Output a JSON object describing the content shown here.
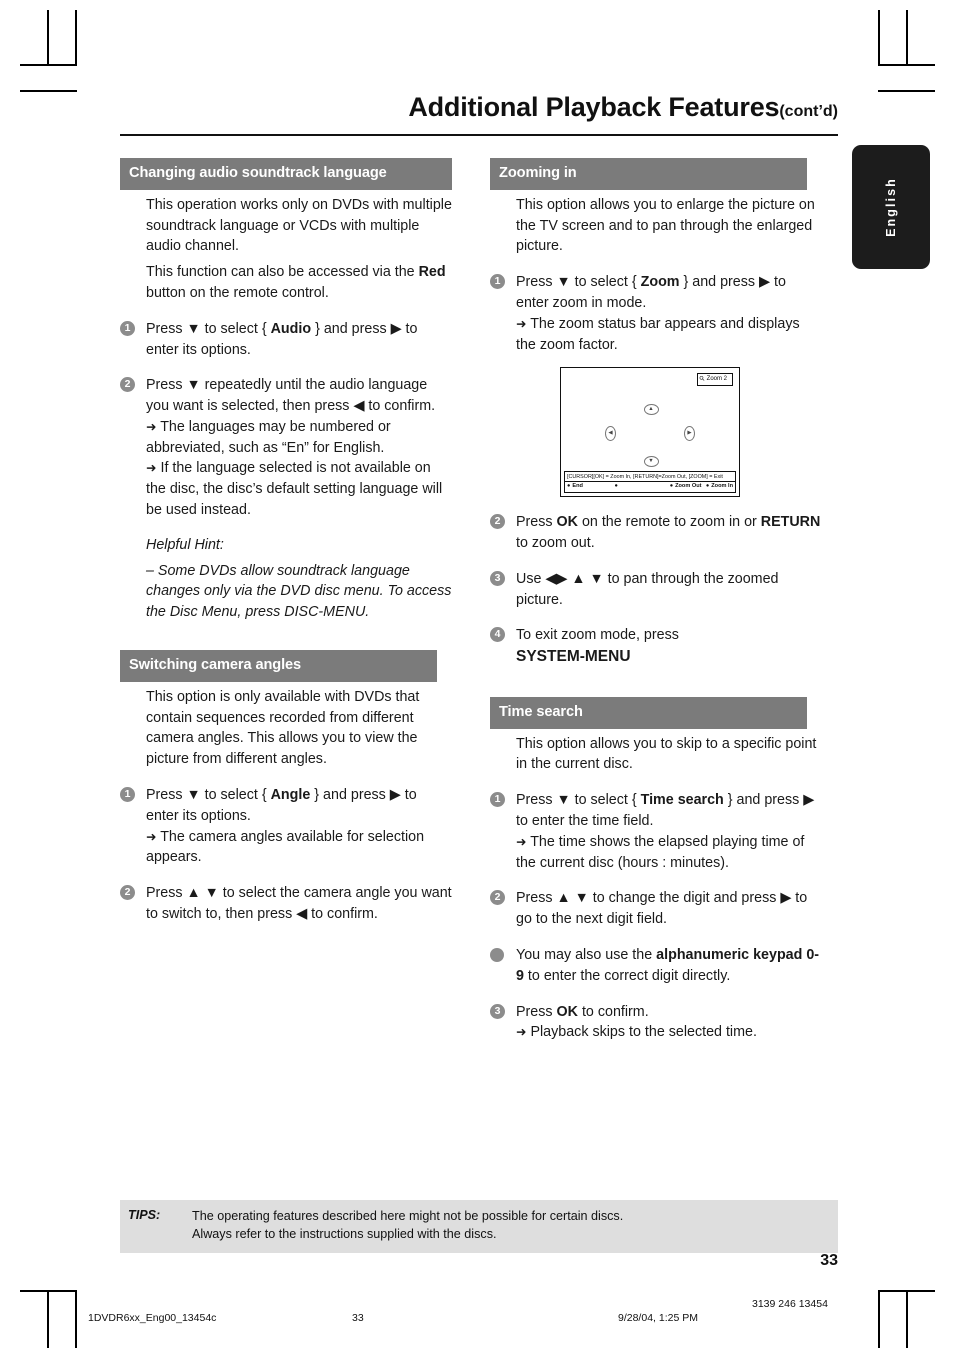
{
  "header": {
    "title": "Additional Playback Features",
    "title_suffix": "(cont’d)"
  },
  "language_tab": {
    "label": "English"
  },
  "left_column": {
    "section1": {
      "heading": "Changing audio soundtrack language",
      "intro_1": "This operation works only on DVDs with multiple soundtrack language or VCDs with multiple audio channel.",
      "intro_2_a": "This function can also be accessed via the ",
      "intro_2_b": "Red",
      "intro_2_c": " button on the remote control.",
      "steps": [
        {
          "num": "1",
          "text_a": "Press ▼  to select { ",
          "bold": "Audio",
          "text_b": " } and press ▶ to enter its options."
        },
        {
          "num": "2",
          "text_a": "Press ▼ repeatedly until the audio language you want is selected, then press ◀  to confirm.",
          "arrow_1": "The languages may be numbered or abbreviated, such as “En” for English.",
          "arrow_2": "If the language selected is not available on the disc, the disc’s default setting language will be used instead."
        }
      ],
      "hint_title": "Helpful Hint:",
      "hint_body": "–  Some DVDs allow soundtrack language changes only via the DVD disc menu. To access the Disc Menu, press DISC-MENU."
    },
    "section2": {
      "heading": "Switching camera angles",
      "intro": "This option is only available with DVDs that contain sequences recorded from different camera angles.  This allows you to view the picture from different angles.",
      "steps": [
        {
          "num": "1",
          "text_a": "Press ▼  to select { ",
          "bold": "Angle",
          "text_b": " } and press ▶ to enter its options.",
          "arrow_1": "The camera angles available for selection appears."
        },
        {
          "num": "2",
          "text_a": "Press ▲ ▼ to select the camera angle you want to switch to, then press ◀  to confirm."
        }
      ]
    }
  },
  "right_column": {
    "section1": {
      "heading": "Zooming in",
      "intro": "This option allows you to enlarge the picture on the TV screen and to pan through the enlarged picture.",
      "steps": [
        {
          "num": "1",
          "text_a": "Press ▼  to select { ",
          "bold": "Zoom",
          "text_b": " } and press ▶ to enter zoom in mode.",
          "arrow_1": "The zoom status bar appears and displays the zoom factor."
        },
        {
          "num": "2",
          "text_a": "Press ",
          "bold": "OK",
          "text_b": " on the remote to zoom in or ",
          "bold2": "RETURN",
          "text_c": " to zoom out."
        },
        {
          "num": "3",
          "text_a": "Use ◀▶ ▲ ▼ to pan through the zoomed picture."
        },
        {
          "num": "4",
          "text_a": "To exit zoom mode, press ",
          "bold": "SYSTEM-MENU"
        }
      ],
      "figure": {
        "zoom_badge": "Zoom 2",
        "magnifier_icon": "search-icon",
        "arrow_up": "▲",
        "arrow_down": "▼",
        "arrow_left": "◀",
        "arrow_right": "▶",
        "osd_hint": "[CURSOR][OK] = Zoom In, [RETURN]=Zoom Out, [ZOOM] = Exit",
        "osd_items": [
          "End",
          "",
          "Zoom Out",
          "Zoom In"
        ]
      }
    },
    "section2": {
      "heading": "Time search",
      "intro": "This option allows you to skip to a specific point in the current disc.",
      "steps": [
        {
          "num": "1",
          "text_a": "Press ▼  to select { ",
          "bold": "Time search",
          "text_b": " } and press ▶ to enter the time field.",
          "arrow_1": "The time shows the elapsed playing time of the current disc (hours : minutes)."
        },
        {
          "num": "2",
          "text_a": "Press ▲ ▼ to change the digit and press ▶ to go to the next digit field."
        },
        {
          "num": "•",
          "text_a": "You may also use the ",
          "bold": "alphanumeric keypad 0-9",
          "text_b": " to enter the correct digit directly."
        },
        {
          "num": "3",
          "text_a": "Press ",
          "bold": "OK",
          "text_b": " to confirm.",
          "arrow_1": "Playback skips to the selected time."
        }
      ]
    }
  },
  "tips": {
    "label": "TIPS:",
    "line1": "The operating features described here might not be possible for certain discs.",
    "line2": "Always refer to the instructions supplied with the discs."
  },
  "page_number": "33",
  "printer_footer": {
    "file": "1DVDR6xx_Eng00_13454c",
    "page": "33",
    "date": "9/28/04, 1:25 PM",
    "code": "3139 246 13454"
  },
  "colors": {
    "section_header_bg": "#7b7b7b",
    "step_bullet_bg": "#8c8c8c",
    "tips_bg": "#dedede",
    "tab_bg": "#1c1c1c"
  }
}
